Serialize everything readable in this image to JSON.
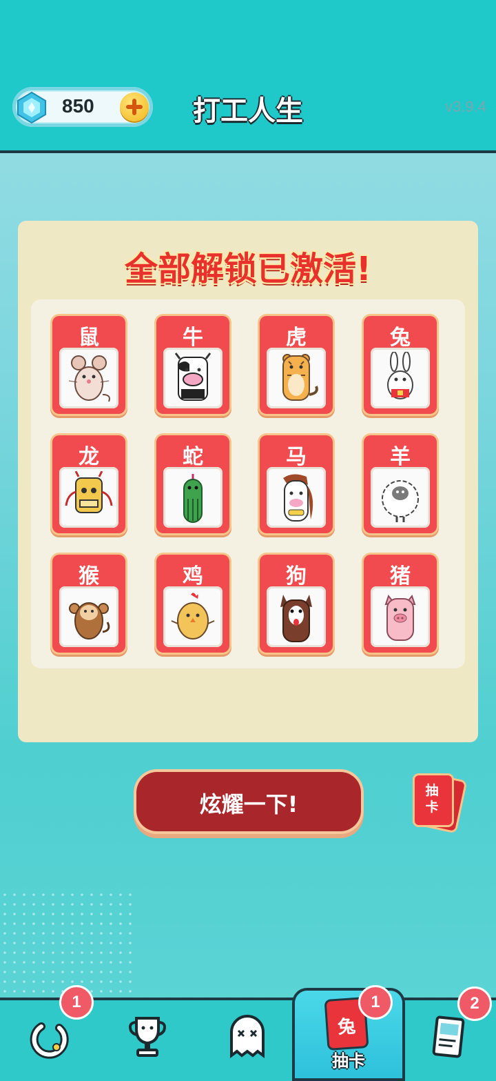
{
  "header": {
    "gem_count": "850",
    "title": "打工人生",
    "version": "v3.9.4"
  },
  "panel": {
    "title": "全部解锁已激活!",
    "cards": [
      {
        "label": "鼠",
        "icon": "rat-icon"
      },
      {
        "label": "牛",
        "icon": "ox-icon"
      },
      {
        "label": "虎",
        "icon": "tiger-icon"
      },
      {
        "label": "兔",
        "icon": "rabbit-icon"
      },
      {
        "label": "龙",
        "icon": "dragon-icon"
      },
      {
        "label": "蛇",
        "icon": "snake-icon"
      },
      {
        "label": "马",
        "icon": "horse-icon"
      },
      {
        "label": "羊",
        "icon": "sheep-icon"
      },
      {
        "label": "猴",
        "icon": "monkey-icon"
      },
      {
        "label": "鸡",
        "icon": "chicken-icon"
      },
      {
        "label": "狗",
        "icon": "dog-icon"
      },
      {
        "label": "猪",
        "icon": "pig-icon"
      }
    ]
  },
  "actions": {
    "show_off_label": "炫耀一下!",
    "draw_deck_label": "抽卡"
  },
  "bottom_nav": {
    "items": [
      {
        "icon": "ring-icon",
        "badge": "1"
      },
      {
        "icon": "trophy-icon",
        "badge": ""
      },
      {
        "icon": "ghost-icon",
        "badge": ""
      },
      {
        "icon": "card-icon",
        "label": "抽卡",
        "card_text": "兔",
        "badge": "1",
        "active": true
      },
      {
        "icon": "book-icon",
        "badge": "2"
      }
    ]
  },
  "colors": {
    "header_bg": "#1fc8c9",
    "card_red": "#f24b4f",
    "button_red": "#a9262a",
    "panel_bg": "#efe8c4"
  }
}
